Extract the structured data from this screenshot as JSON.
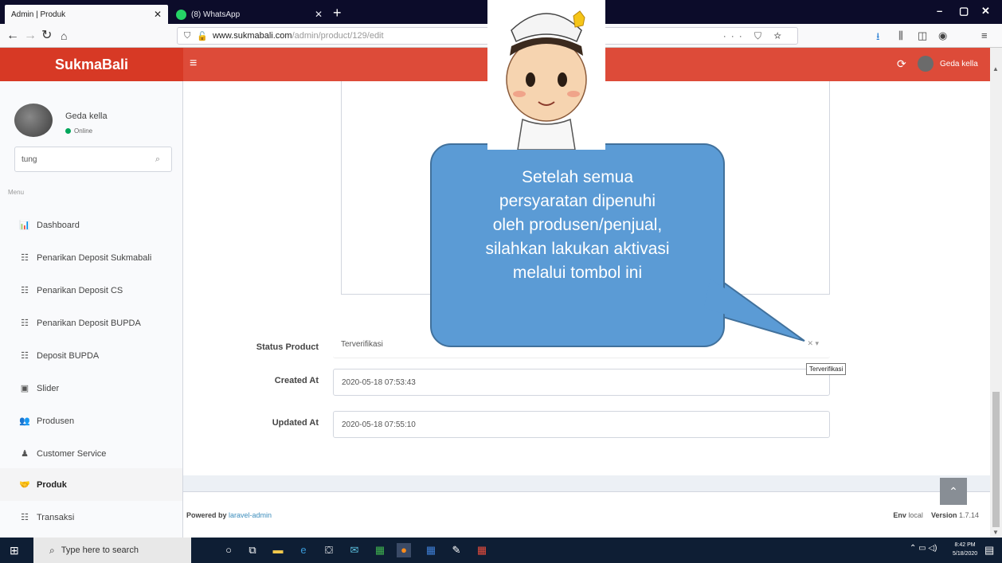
{
  "browser": {
    "tabs": [
      {
        "title": "Admin | Produk",
        "active": true
      },
      {
        "title": "(8) WhatsApp",
        "active": false
      }
    ],
    "url_domain": "www.sukmabali.com",
    "url_path": "/admin/product/129/edit",
    "url_extras": "··· ⛉ ☆"
  },
  "app": {
    "brand": "SukmaBali",
    "header_user": "Geda kella",
    "accent_color": "#dd4b39"
  },
  "sidebar": {
    "user_name": "Geda kella",
    "user_status": "Online",
    "search_value": "tung",
    "menu_label": "Menu",
    "items": [
      {
        "label": "Dashboard",
        "icon": "bar-chart-icon"
      },
      {
        "label": "Penarikan Deposit Sukmabali",
        "icon": "list-icon"
      },
      {
        "label": "Penarikan Deposit CS",
        "icon": "list-icon"
      },
      {
        "label": "Penarikan Deposit BUPDA",
        "icon": "list-icon"
      },
      {
        "label": "Deposit BUPDA",
        "icon": "list-icon"
      },
      {
        "label": "Slider",
        "icon": "image-icon"
      },
      {
        "label": "Produsen",
        "icon": "users-icon"
      },
      {
        "label": "Customer Service",
        "icon": "user-icon"
      },
      {
        "label": "Produk",
        "icon": "handshake-icon",
        "active": true
      },
      {
        "label": "Transaksi",
        "icon": "list-icon"
      }
    ]
  },
  "form": {
    "status_label": "Status Product",
    "status_value": "Terverifikasi",
    "status_tooltip": "Terverifikasi",
    "created_label": "Created At",
    "created_value": "2020-05-18 07:53:43",
    "updated_label": "Updated At",
    "updated_value": "2020-05-18 07:55:10"
  },
  "footer": {
    "powered_prefix": "Powered by",
    "powered_link": "laravel-admin",
    "env_label": "Env",
    "env_value": "local",
    "version_label": "Version",
    "version_value": "1.7.14"
  },
  "callout": {
    "text_lines": [
      "Setelah semua",
      "persyaratan dipenuhi",
      "oleh produsen/penjual,",
      "silahkan lakukan aktivasi",
      "melalui tombol ini"
    ],
    "color": "#5b9bd5"
  },
  "taskbar": {
    "search_placeholder": "Type here to search",
    "time": "8:42 PM",
    "date": "5/18/2020"
  }
}
